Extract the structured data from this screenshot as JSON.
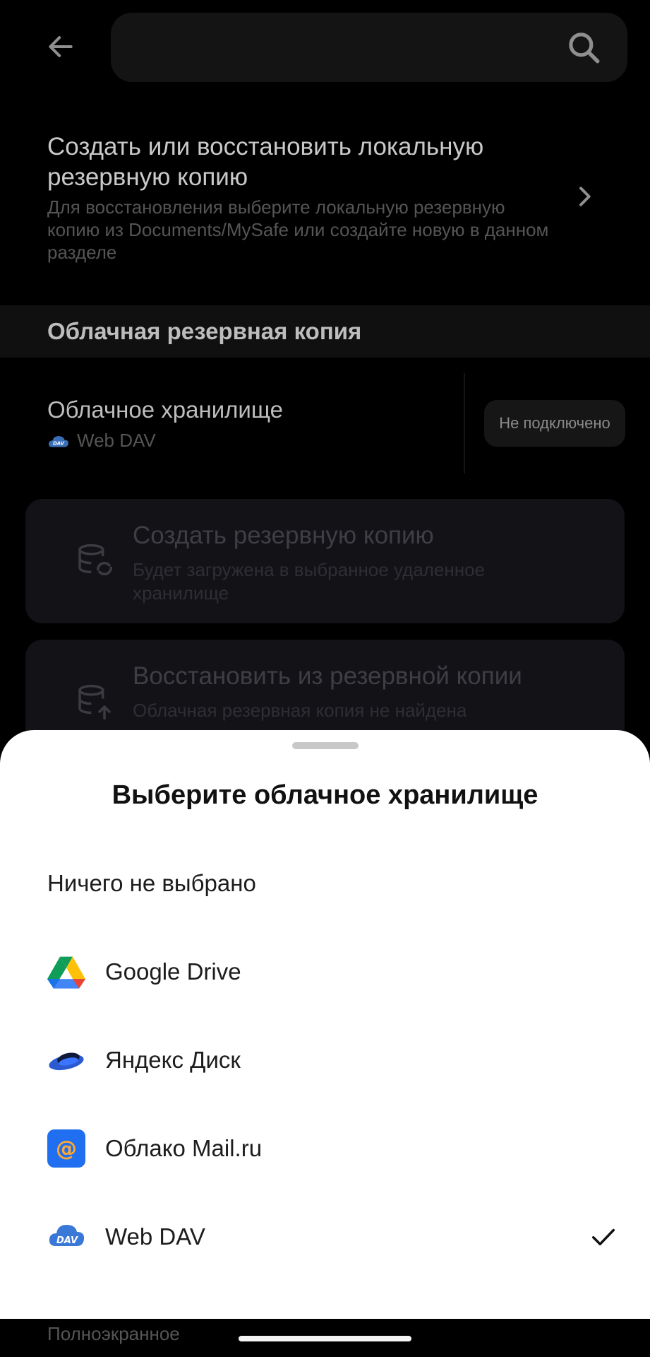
{
  "local_backup": {
    "title": "Создать или восстановить локальную резервную копию",
    "subtitle": "Для восстановления выберите локальную резервную копию из Documents/MySafe или создайте новую в данном разделе"
  },
  "cloud_section": {
    "header": "Облачная резервная копия",
    "storage_title": "Облачное хранилище",
    "storage_value": "Web DAV",
    "status": "Не подключено"
  },
  "cards": [
    {
      "title": "Создать резервную копию",
      "subtitle": "Будет загружена в выбранное удаленное хранилище"
    },
    {
      "title": "Восстановить из резервной копии",
      "subtitle": "Облачная резервная копия не найдена"
    }
  ],
  "bottom_peek": "Полноэкранное",
  "sheet": {
    "title": "Выберите облачное хранилище",
    "options": [
      {
        "label": "Ничего не выбрано",
        "icon": "none"
      },
      {
        "label": "Google Drive",
        "icon": "google-drive-icon"
      },
      {
        "label": "Яндекс Диск",
        "icon": "yandex-disk-icon"
      },
      {
        "label": "Облако Mail.ru",
        "icon": "mail-ru-cloud-icon"
      },
      {
        "label": "Web DAV",
        "icon": "webdav-icon",
        "selected": true
      }
    ]
  },
  "colors": {
    "background": "#000000",
    "sheet": "#ffffff",
    "mail_blue": "#1f6ff0"
  }
}
